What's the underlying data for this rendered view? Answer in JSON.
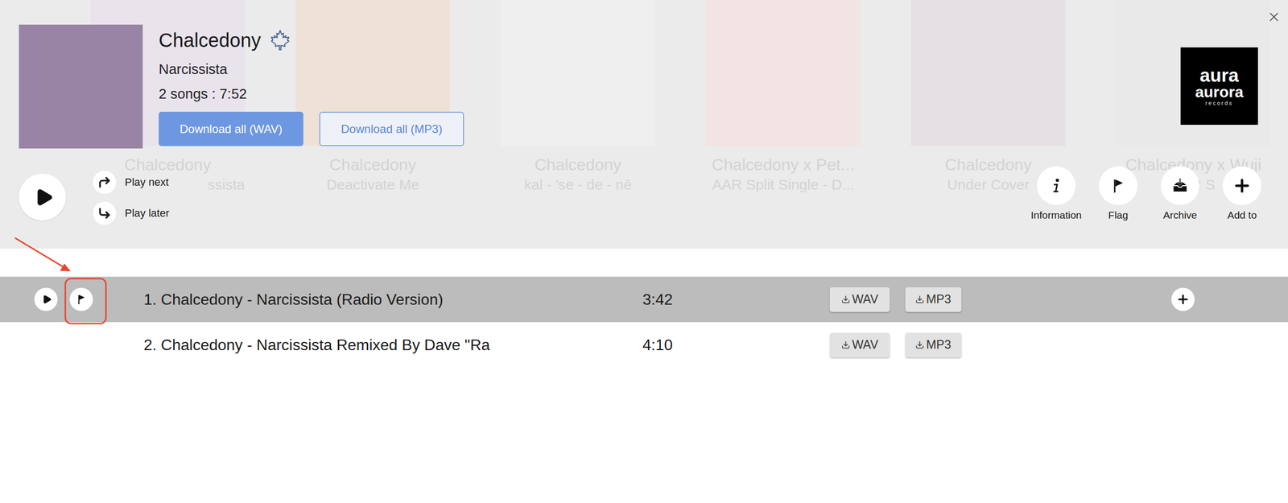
{
  "carousel": [
    {
      "title": "Chalcedony",
      "subtitle": "ssista"
    },
    {
      "title": "Chalcedony",
      "subtitle": "Deactivate Me"
    },
    {
      "title": "Chalcedony",
      "subtitle": "kal - 'se - de - nē"
    },
    {
      "title": "Chalcedony x Pet...",
      "subtitle": "AAR Split Single - D..."
    },
    {
      "title": "Chalcedony",
      "subtitle": "Under Cover"
    },
    {
      "title": "Chalcedony x Wuji",
      "subtitle": "AAR S"
    }
  ],
  "release": {
    "title": "Chalcedony",
    "artist": "Narcissista",
    "summary": "2 songs : 7:52",
    "download_wav": "Download all (WAV)",
    "download_mp3": "Download all (MP3)"
  },
  "label_logo": {
    "line1": "aura",
    "line2": "aurora",
    "line3": "records"
  },
  "queue": {
    "play_next": "Play next",
    "play_later": "Play later"
  },
  "actions": [
    {
      "label": "Information"
    },
    {
      "label": "Flag"
    },
    {
      "label": "Archive"
    },
    {
      "label": "Add to"
    }
  ],
  "tracks": [
    {
      "title": "1. Chalcedony - Narcissista (Radio Version)",
      "duration": "3:42",
      "wav": "WAV",
      "mp3": "MP3",
      "selected": true
    },
    {
      "title": "2. Chalcedony - Narcissista Remixed By Dave \"Ra",
      "duration": "4:10",
      "wav": "WAV",
      "mp3": "MP3",
      "selected": false
    }
  ]
}
